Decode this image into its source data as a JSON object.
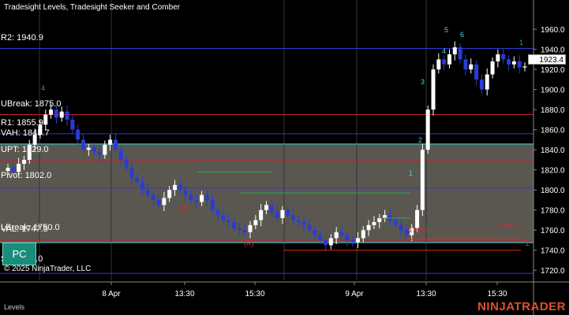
{
  "header": {
    "title": "Tradesight Levels, Tradesight Seeker and Comber"
  },
  "copyright": "© 2025 NinjaTrader, LLC",
  "footer_tab": "Levels",
  "brand": "NINJATRADER",
  "pc_button": "PC",
  "current_price": "1923.4",
  "level_labels": {
    "r2": "R2: 1940.9",
    "ubreak": "UBreak: 1875.0",
    "r1": "R1: 1855.9",
    "vah": "VAH: 1845.7",
    "upt": "UPT: 1829.0",
    "pivot": "Pivot: 1802.0",
    "lbreak": "LBreak: 1750.0",
    "val": "VAL: 1747.5",
    "s1": "S1: 1747.0"
  },
  "annotations": {
    "r_mark": "(R)",
    "one_mark": "1",
    "seq_1": "1",
    "seq_2": "2",
    "seq_3": "3",
    "seq_4": "4",
    "seq_5": "5",
    "seq_6": "6",
    "val_red_1": "1749.3",
    "val_red_2": "1761.1"
  },
  "colors": {
    "background": "#000000",
    "level_blue": "#2a3bd6",
    "level_red": "#c8202a",
    "level_cyan": "#3fd8e0",
    "value_area": "#5a5750",
    "candle_up": "#ffffff",
    "candle_down": "#2a3bd6",
    "seq_green": "#2fa84f",
    "seq_cyan": "#3fd8e0",
    "mark_red": "#e02828"
  },
  "chart_data": {
    "type": "candlestick",
    "y_axis": {
      "ticks": [
        1720,
        1740,
        1760,
        1780,
        1800,
        1820,
        1840,
        1860,
        1880,
        1900,
        1920,
        1940,
        1960
      ]
    },
    "x_axis": {
      "ticks": [
        "8 Apr",
        "13:30",
        "15:30",
        "9 Apr",
        "13:30",
        "15:30"
      ]
    },
    "value_area": [
      1747.5,
      1845.7
    ],
    "levels": [
      {
        "name": "R2",
        "value": 1940.9,
        "color": "#2a3bd6"
      },
      {
        "name": "UBreak",
        "value": 1875.0,
        "color": "#c8202a"
      },
      {
        "name": "R1",
        "value": 1855.9,
        "color": "#2a3bd6"
      },
      {
        "name": "VAH",
        "value": 1845.7,
        "color": "#3fd8e0"
      },
      {
        "name": "UPT",
        "value": 1829.0,
        "color": "#c8202a"
      },
      {
        "name": "Pivot",
        "value": 1802.0,
        "color": "#2a3bd6"
      },
      {
        "name": "LBreak",
        "value": 1750.0,
        "color": "#c8202a"
      },
      {
        "name": "VAL",
        "value": 1747.5,
        "color": "#3fd8e0"
      },
      {
        "name": "S1",
        "value": 1717.0,
        "color": "#2a3bd6"
      }
    ],
    "last_price": 1923.4,
    "close_path": [
      1822,
      1818,
      1826,
      1830,
      1845,
      1855,
      1865,
      1875,
      1880,
      1872,
      1878,
      1870,
      1860,
      1850,
      1840,
      1842,
      1838,
      1835,
      1845,
      1850,
      1840,
      1830,
      1822,
      1812,
      1808,
      1800,
      1795,
      1790,
      1785,
      1792,
      1800,
      1805,
      1800,
      1795,
      1790,
      1788,
      1795,
      1790,
      1780,
      1775,
      1770,
      1768,
      1762,
      1760,
      1758,
      1765,
      1770,
      1780,
      1785,
      1778,
      1772,
      1780,
      1775,
      1770,
      1768,
      1765,
      1760,
      1755,
      1750,
      1745,
      1752,
      1758,
      1755,
      1750,
      1748,
      1752,
      1760,
      1765,
      1768,
      1772,
      1775,
      1770,
      1765,
      1760,
      1755,
      1762,
      1780,
      1840,
      1880,
      1920,
      1930,
      1925,
      1935,
      1942,
      1930,
      1920,
      1925,
      1910,
      1900,
      1915,
      1928,
      1935,
      1930,
      1925,
      1928,
      1922,
      1923
    ]
  }
}
